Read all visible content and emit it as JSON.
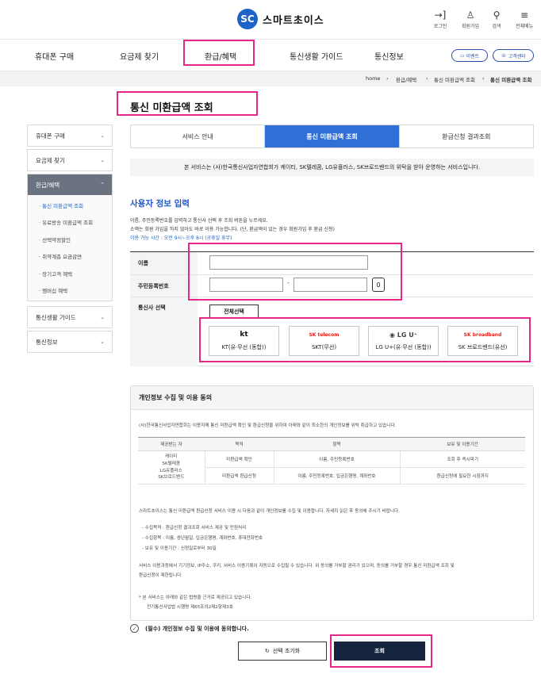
{
  "brand": {
    "mark": "SC",
    "name": "스마트초이스"
  },
  "utility": [
    {
      "icon": "→]",
      "label": "로그인"
    },
    {
      "icon": "♙",
      "label": "회원가입"
    },
    {
      "icon": "⚲",
      "label": "검색"
    },
    {
      "icon": "≡",
      "label": "전체메뉴"
    }
  ],
  "gnb": [
    "휴대폰 구매",
    "요금제 찾기",
    "환급/혜택",
    "통신생활 가이드",
    "통신정보"
  ],
  "pills": [
    {
      "icon": "▭",
      "label": "이벤트"
    },
    {
      "icon": "☏",
      "label": "고객센터"
    }
  ],
  "breadcrumb": [
    "home",
    "›",
    "환급/혜택",
    "›",
    "통신 미환급액 조회",
    "›",
    "통신 미환급액 조회"
  ],
  "page_title": "통신 미환급액 조회",
  "sidebar": {
    "collapsed_top": [
      "휴대폰 구매",
      "요금제 찾기"
    ],
    "open_head": "환급/혜택",
    "sub_items": [
      "· 통신 미환급액 조회",
      "· 유료방송 미환급액 조회",
      "· 선택약정할인",
      "· 취약계층 요금감면",
      "· 장기고객 혜택",
      "· 멤버십 혜택"
    ],
    "collapsed_bottom": [
      "통신생활 가이드",
      "통신정보"
    ],
    "chevron_down": "⌄",
    "chevron_up": "⌃"
  },
  "tabs": [
    "서비스 안내",
    "통신 미환급액 조회",
    "환급신청 결과조회"
  ],
  "notice": "본 서비스는 (사)한국통신사업자연합회가 케이티, SK텔레콤, LG유플러스, SK브로드밴드의 위탁을 받아 운영하는 서비스입니다.",
  "form": {
    "section_title": "사용자 정보 입력",
    "guide_1": "이름, 주민등록번호를 입력하고 통신사 선택 후 조회 버튼을 누르세요.",
    "guide_2": "소액는 회원 가입을 하지 않아도 바로 이용 가능합니다. (단, 환급액이 있는 경우 회원가입 후 환급 신청)",
    "guide_3": "이용 가능 시간 : 오전 9시~오후 8시 (공휴일 휴무)",
    "name_label": "이름",
    "rrn_label": "주민등록번호",
    "rrn_dash": "-",
    "reveal_icon": "0",
    "carrier_label": "통신사 선택",
    "select_all": "전체선택",
    "carriers": [
      {
        "mark": "kt",
        "name": "KT(유·무선 (동합))"
      },
      {
        "mark": "SK telecom",
        "name": "SKT(무선)"
      },
      {
        "mark": "◉ LG U⁺",
        "name": "LG U+(유·무선 (동합))"
      },
      {
        "mark": "SK broadband",
        "name": "SK 브로드밴드(유선)"
      }
    ]
  },
  "privacy": {
    "title": "개인정보 수집 및 이용 동의",
    "intro": "(사)한국통신사업자연합회는 이용자께 통신 미환급액 확인 및 환급신청을 위하여 아래와 같이 최소한의 개인정보를 위탁 취급하고 있습니다.",
    "headers": [
      "제공받는 자",
      "목적",
      "항목",
      "보유 및 이용기간"
    ],
    "providers": "케이티\nSK텔레콤\nLG유플러스\nSK브로드밴드",
    "rows": [
      {
        "purpose": "미환급액 확인",
        "items": "이름, 주민등록번호",
        "period": "조회 후 즉시파기"
      },
      {
        "purpose": "미환급액 환급신청",
        "items": "이름, 주민등록번호, 입금은행명, 계좌번호",
        "period": "환급신청에 필요한 시점까지"
      }
    ],
    "para_1": "스마트초이스는 통신 미환급액 환급신청 서비스 이용 시 다음과 같이 개인정보를 수집 및 이용합니다. 자세히 읽은 후 동의해 주시기 바랍니다.",
    "bullet_1": "- 수집목적 : 환급신청 결과조회 서비스 제공 및 민원처리",
    "bullet_2": "- 수집항목 : 이름, 생년월일, 입금은행명, 계좌번호, 휴대전화번호",
    "bullet_3": "- 보유 및 이용기간 : 신청일로부터 30일",
    "para_2a": "서비스 이용과정에서 기기정보, IP주소, 쿠키, 서비스 이용기록이 자동으로 수집될 수 있습니다. 위 동의를 거부할 권리가 있으며, 동의를 거부할 경우 통신 미환급액 조회 및",
    "para_2b": "환급신청이 제한됩니다.",
    "law_1": "* 본 서비스는 아래와 같은 법령을 근거로 제공되고 있습니다.",
    "law_2": "전기통신사업법 시행령 제65조의2제2항제3호"
  },
  "consent": {
    "icon": "✓",
    "label": "(필수) 개인정보 수집 및 이용에 동의합니다."
  },
  "buttons": {
    "reset_icon": "↻",
    "reset": "선택 초기화",
    "submit": "조회"
  },
  "highlight_color": "#e5278a",
  "accent": "#2f6fd6"
}
